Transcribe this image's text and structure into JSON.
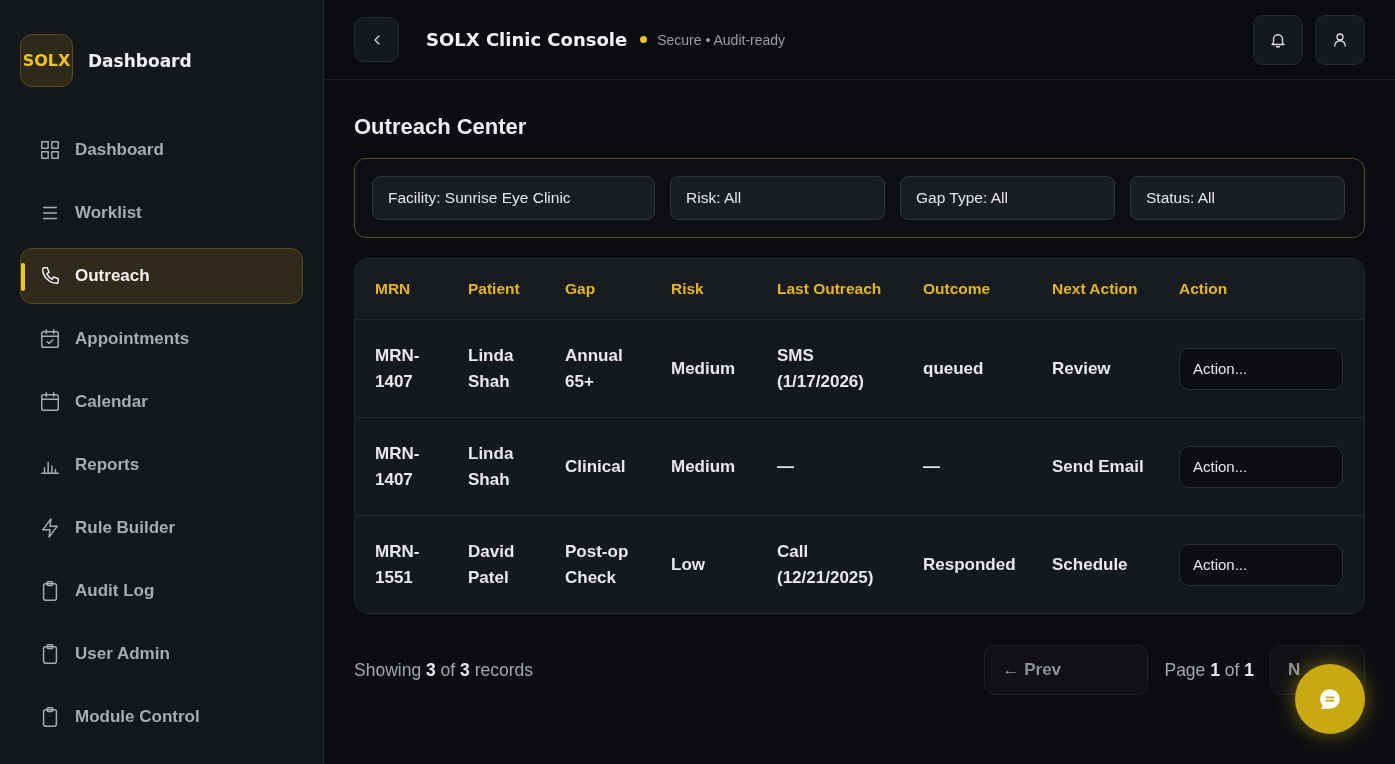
{
  "brand": {
    "logo": "SOLX",
    "title": "Dashboard"
  },
  "sidebar": {
    "items": [
      {
        "label": "Dashboard",
        "selected": false
      },
      {
        "label": "Worklist",
        "selected": false
      },
      {
        "label": "Outreach",
        "selected": true
      },
      {
        "label": "Appointments",
        "selected": false
      },
      {
        "label": "Calendar",
        "selected": false
      },
      {
        "label": "Reports",
        "selected": false
      },
      {
        "label": "Rule Builder",
        "selected": false
      },
      {
        "label": "Audit Log",
        "selected": false
      },
      {
        "label": "User Admin",
        "selected": false
      },
      {
        "label": "Module Control",
        "selected": false
      }
    ]
  },
  "header": {
    "title": "SOLX Clinic Console",
    "status": "Secure • Audit-ready"
  },
  "page_title": "Outreach Center",
  "filters": [
    {
      "value": "Facility: Sunrise Eye Clinic"
    },
    {
      "value": "Risk: All"
    },
    {
      "value": "Gap Type: All"
    },
    {
      "value": "Status: All"
    }
  ],
  "table": {
    "columns": [
      "MRN",
      "Patient",
      "Gap",
      "Risk",
      "Last Outreach",
      "Outcome",
      "Next Action",
      "Action"
    ],
    "rows": [
      {
        "cells": [
          "MRN-1407",
          "Linda Shah",
          "Annual 65+",
          "Medium",
          "SMS (1/17/2026)",
          "queued",
          "Review"
        ],
        "action": "Action..."
      },
      {
        "cells": [
          "MRN-1407",
          "Linda Shah",
          "Clinical",
          "Medium",
          "—",
          "—",
          "Send Email"
        ],
        "action": "Action..."
      },
      {
        "cells": [
          "MRN-1551",
          "David Patel",
          "Post-op Check",
          "Low",
          "Call (12/21/2025)",
          "Responded",
          "Schedule"
        ],
        "action": "Action..."
      }
    ]
  },
  "pager": {
    "summary": "Showing **3** of **3** records",
    "prev": "← Prev",
    "page": "Page **1** of **1**",
    "next": "N"
  }
}
